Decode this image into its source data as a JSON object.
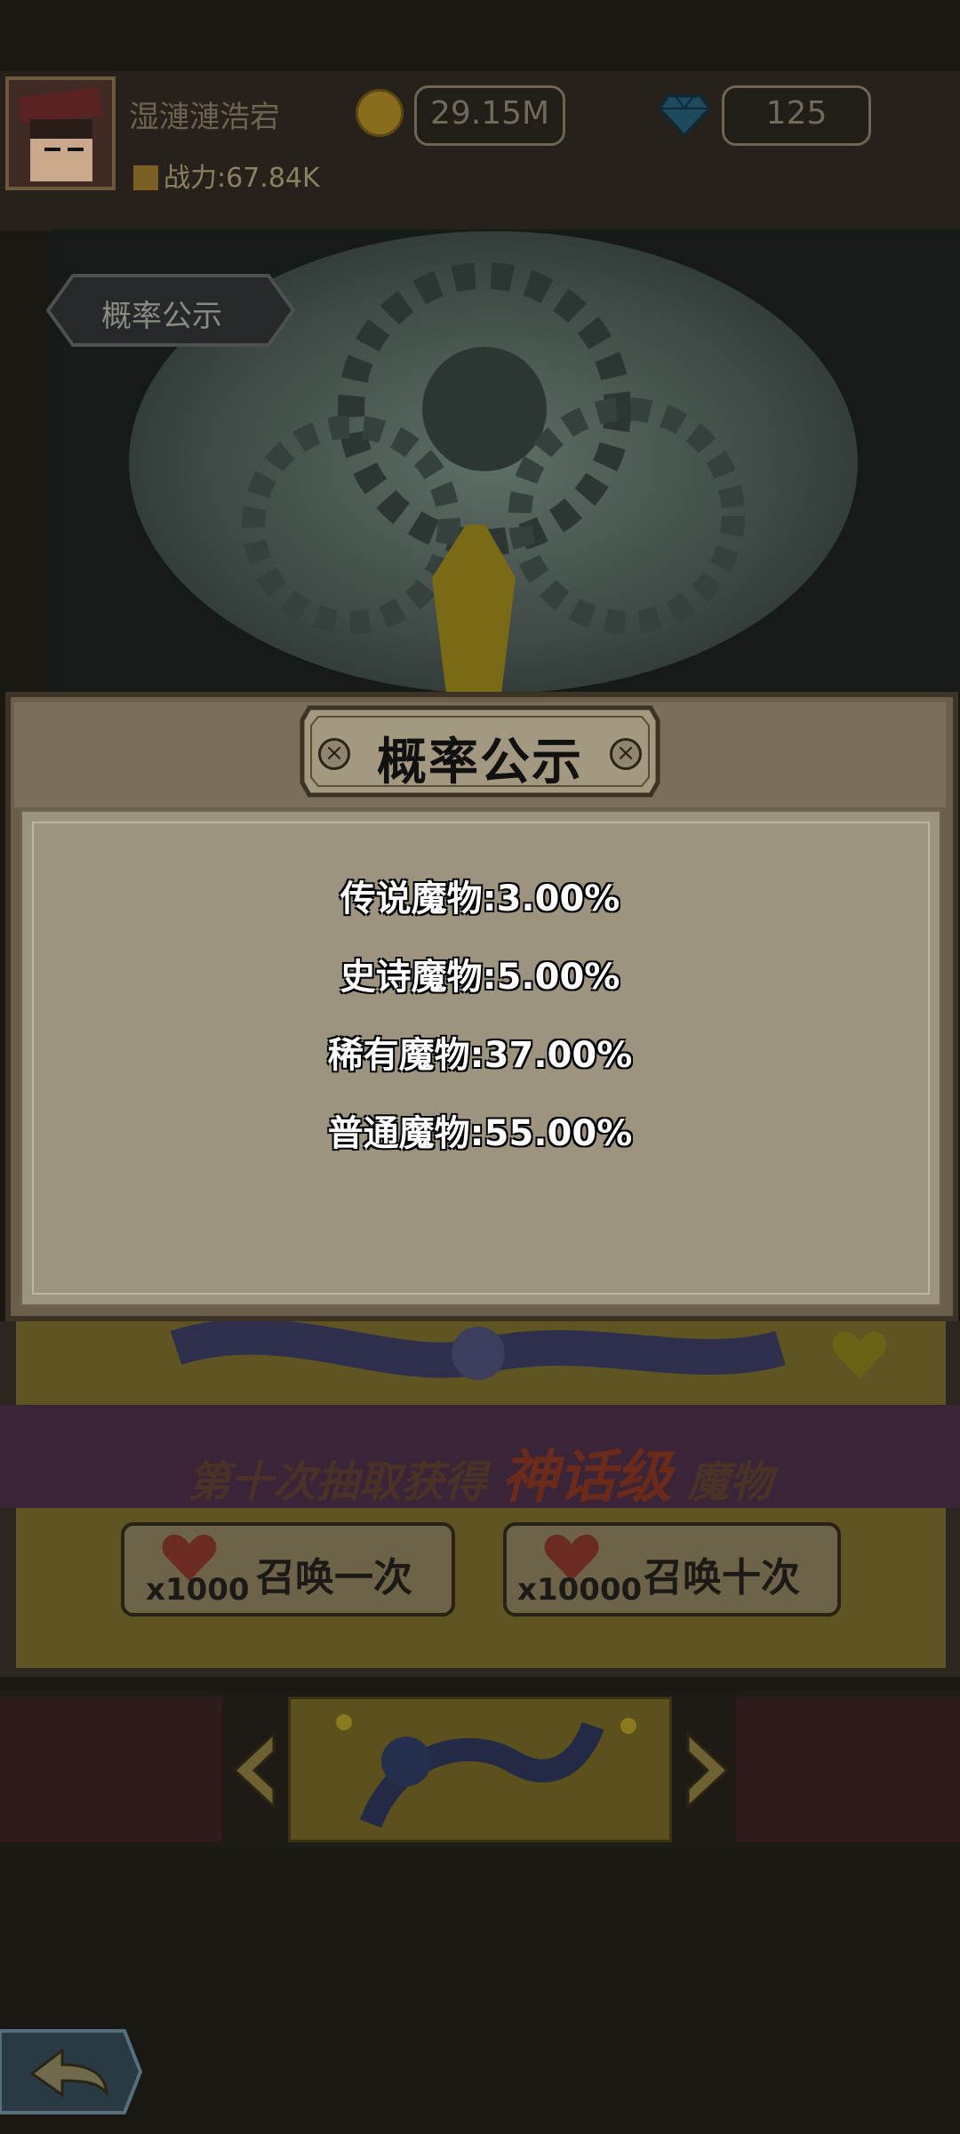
{
  "header": {
    "username": "湿漣漣浩宕",
    "power": "战力:67.84K",
    "gold": "29.15M",
    "gems": "125"
  },
  "scene": {
    "probability_button": "概率公示"
  },
  "dialog": {
    "title": "概率公示",
    "rates": [
      "传说魔物:3.00%",
      "史诗魔物:5.00%",
      "稀有魔物:37.00%",
      "普通魔物:55.00%"
    ]
  },
  "banner": {
    "prefix": "第十次抽取获得",
    "highlight": "神话级",
    "suffix": "魔物"
  },
  "summon": {
    "once_cost": "x1000",
    "once_label": "召唤一次",
    "ten_cost": "x10000",
    "ten_label": "召唤十次"
  },
  "icons": {
    "coin": "coin-icon",
    "gem": "diamond-icon",
    "heart": "heart-icon",
    "back": "back-arrow-icon"
  },
  "colors": {
    "overlay_dim": "#1b1813",
    "dialog_body": "#9d9480",
    "rate_text": "#ffffff"
  }
}
